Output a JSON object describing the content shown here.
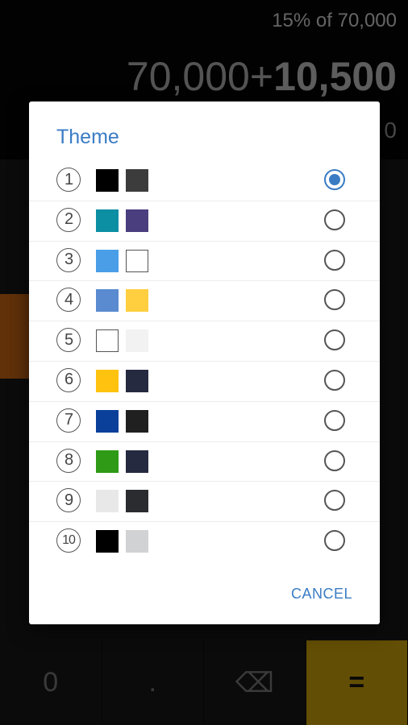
{
  "calculator": {
    "expression_top": "15% of 70,000",
    "display_left": "70,000+",
    "display_bold": "10,500",
    "result_peek": "0",
    "keys": {
      "zero": "0",
      "dot": ".",
      "backspace": "⌫",
      "equals": "="
    }
  },
  "dialog": {
    "title": "Theme",
    "cancel_label": "CANCEL",
    "themes": [
      {
        "number": "1",
        "color_a": "#000000",
        "color_b": "#3c3c3c",
        "selected": true
      },
      {
        "number": "2",
        "color_a": "#0d8fa3",
        "color_b": "#4a3e7e",
        "selected": false
      },
      {
        "number": "3",
        "color_a": "#4a9ee8",
        "color_b": "#ffffff",
        "selected": false
      },
      {
        "number": "4",
        "color_a": "#5a8bd0",
        "color_b": "#ffcf40",
        "selected": false
      },
      {
        "number": "5",
        "color_a": "#ffffff",
        "color_b": "#f2f2f2",
        "selected": false
      },
      {
        "number": "6",
        "color_a": "#ffc20e",
        "color_b": "#262a40",
        "selected": false
      },
      {
        "number": "7",
        "color_a": "#0a3f9a",
        "color_b": "#202020",
        "selected": false
      },
      {
        "number": "8",
        "color_a": "#2e9a16",
        "color_b": "#262a40",
        "selected": false
      },
      {
        "number": "9",
        "color_a": "#e8e8e8",
        "color_b": "#2a2c30",
        "selected": false
      },
      {
        "number": "10",
        "color_a": "#000000",
        "color_b": "#d0d2d4",
        "selected": false
      }
    ]
  }
}
